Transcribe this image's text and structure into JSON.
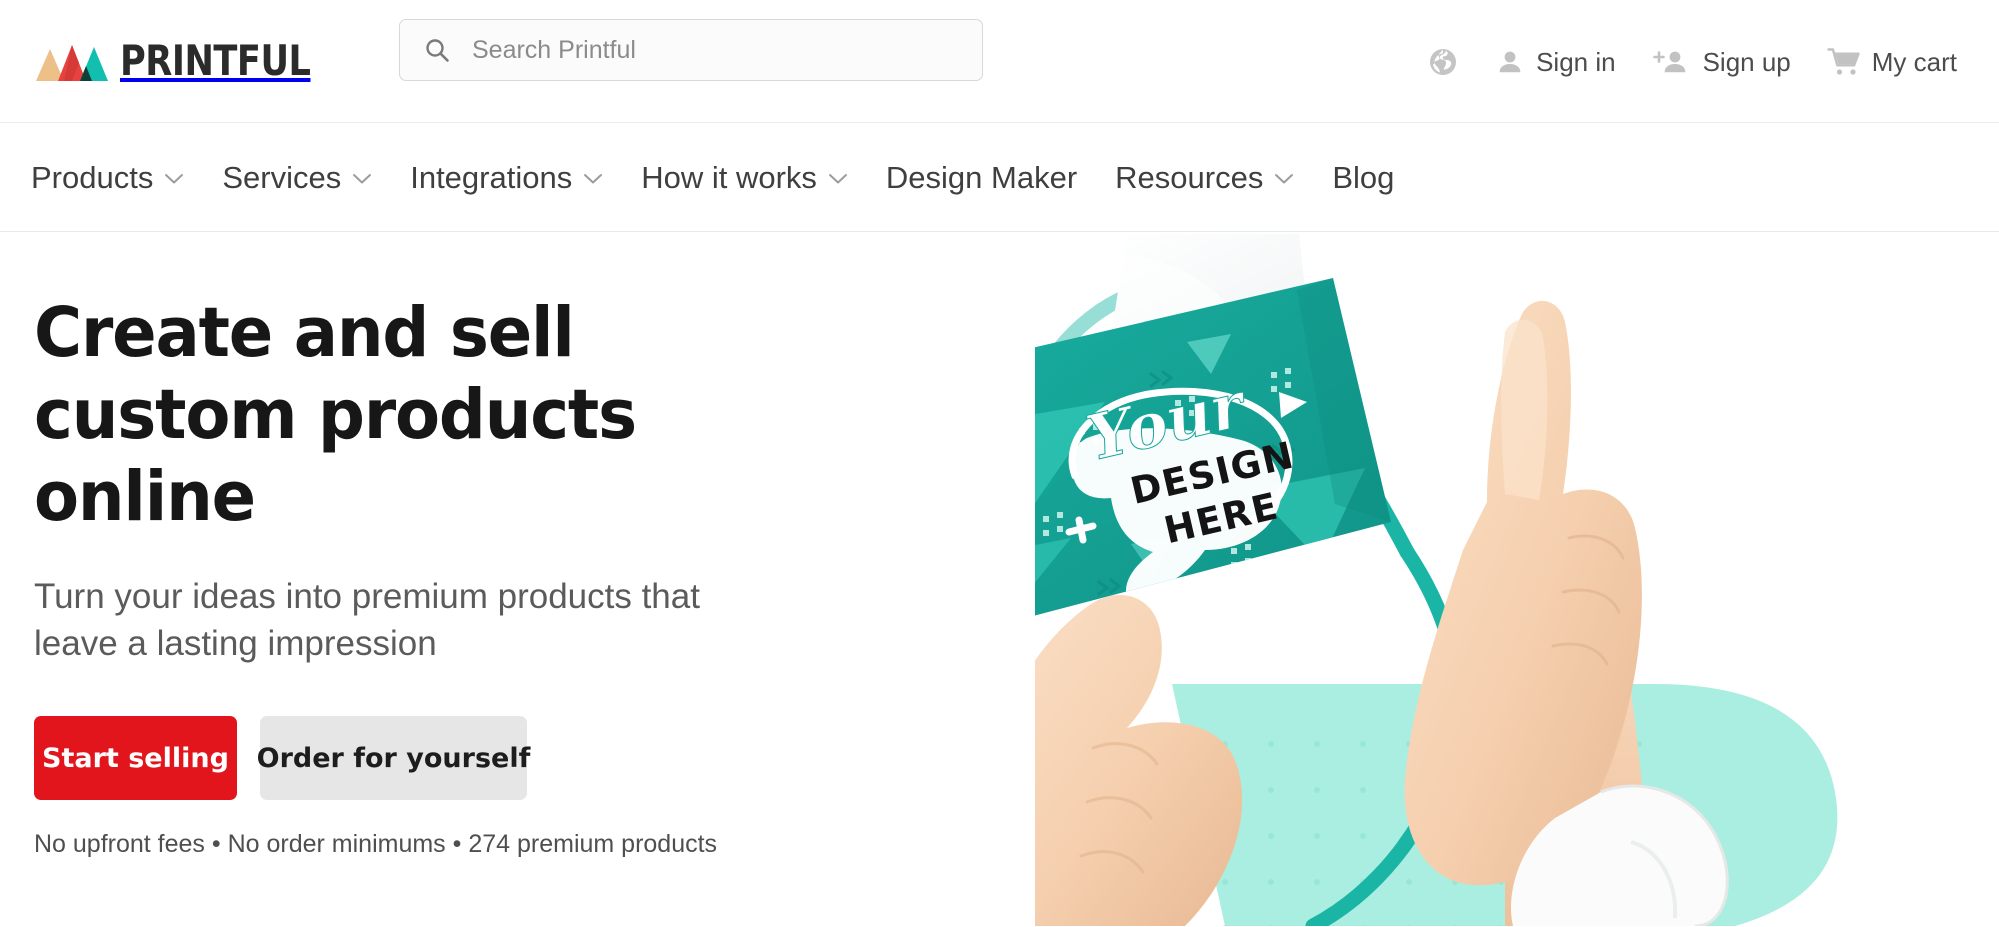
{
  "brand": {
    "name": "PRINTFUL",
    "logo_colors": {
      "tan": "#edc08a",
      "red": "#e8423f",
      "red_dark": "#c8342f",
      "teal": "#12bfae",
      "green_dark": "#0f4037"
    },
    "wordmark_color": "#2b2b2b"
  },
  "search": {
    "placeholder": "Search Printful",
    "value": "",
    "icon": "search-icon"
  },
  "header_actions": [
    {
      "id": "language",
      "icon": "globe-icon",
      "label": ""
    },
    {
      "id": "sign-in",
      "icon": "person-icon",
      "label": "Sign in"
    },
    {
      "id": "sign-up",
      "icon": "person-add-icon",
      "label": "Sign up"
    },
    {
      "id": "my-cart",
      "icon": "cart-icon",
      "label": "My cart"
    }
  ],
  "nav": {
    "items": [
      {
        "label": "Products",
        "has_dropdown": true
      },
      {
        "label": "Services",
        "has_dropdown": true
      },
      {
        "label": "Integrations",
        "has_dropdown": true
      },
      {
        "label": "How it works",
        "has_dropdown": true
      },
      {
        "label": "Design Maker",
        "has_dropdown": false
      },
      {
        "label": "Resources",
        "has_dropdown": true
      },
      {
        "label": "Blog",
        "has_dropdown": false
      }
    ]
  },
  "hero": {
    "title": "Create and sell custom products online",
    "subtitle": "Turn your ideas into premium products that leave a lasting impression",
    "primary_button": "Start selling",
    "secondary_button": "Order for yourself",
    "note": "No upfront fees • No order minimums • 274 premium products",
    "note_product_count": "274",
    "image": {
      "alt": "Hands holding a teal gift bag with a custom design",
      "card_text_script": "Your",
      "card_text_line2": "DESIGN",
      "card_text_line3": "HERE",
      "bag_color": "#16a89b",
      "bag_color_light": "#2ebcae",
      "backdrop_color": "#aaeee1",
      "handle_color": "#1ab5a4",
      "triangle_color": "#f0c394",
      "skin_color": "#f6d3b4",
      "sleeve_color": "#fbfbfb"
    }
  },
  "colors": {
    "accent_red": "#e3151c",
    "button_gray": "#e6e6e6",
    "text_dark": "#171717",
    "text_muted": "#5b5b5b",
    "border": "#e8e8e8"
  }
}
